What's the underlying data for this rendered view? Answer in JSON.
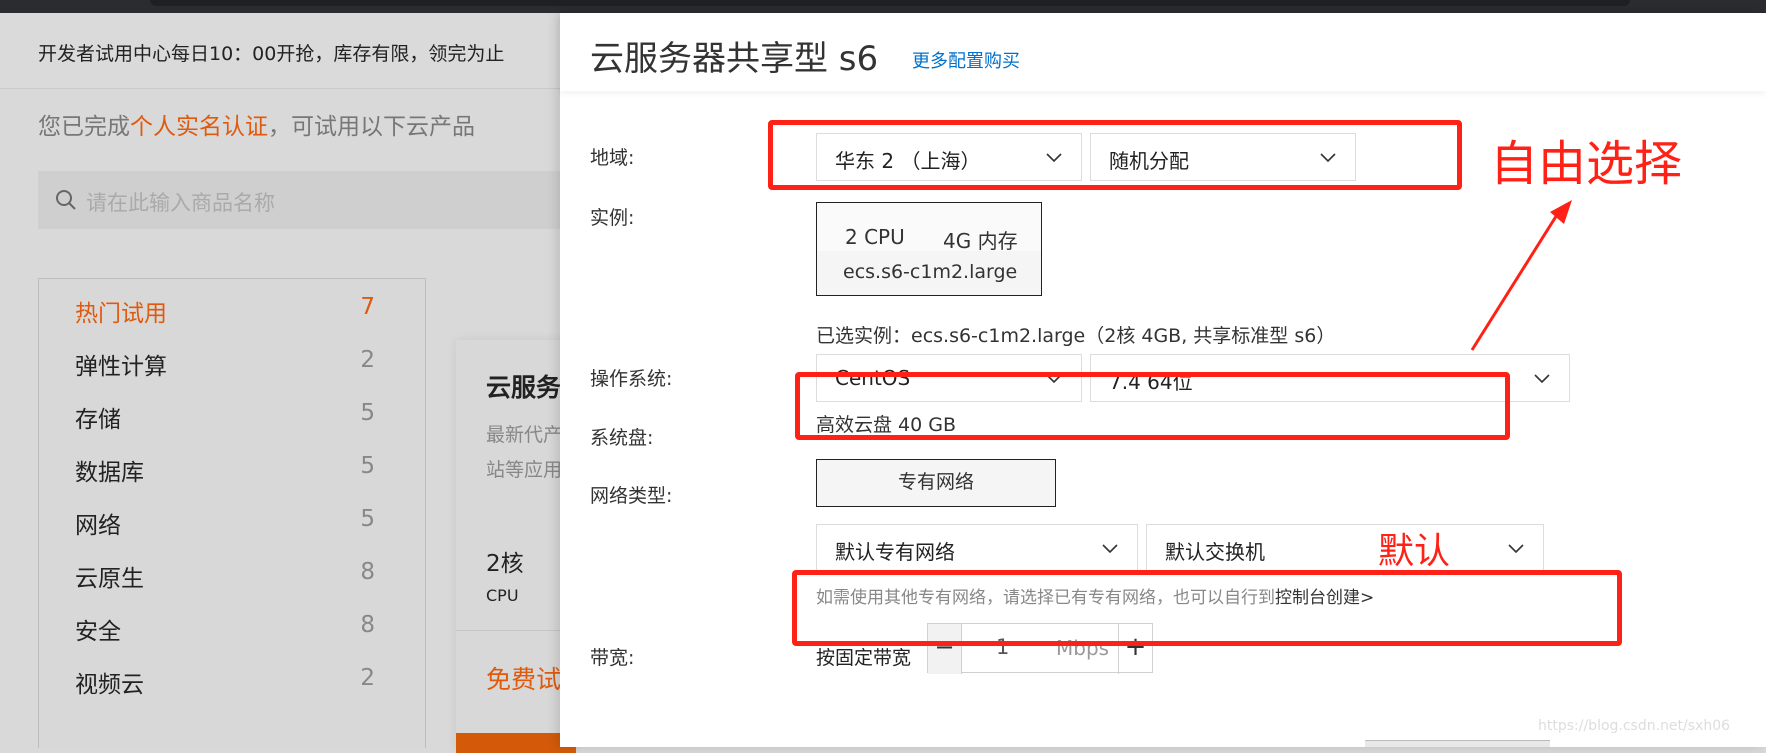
{
  "background_page": {
    "notice": "开发者试用中心每日10：00开抢，库存有限，领完为止",
    "verified_prefix": "您已完成",
    "verified_highlight": "个人实名认证",
    "verified_suffix": "，可试用以下云产品",
    "search_placeholder": "请在此输入商品名称",
    "categories": [
      {
        "label": "热门试用",
        "count": "7",
        "active": true
      },
      {
        "label": "弹性计算",
        "count": "2"
      },
      {
        "label": "存储",
        "count": "5"
      },
      {
        "label": "数据库",
        "count": "5"
      },
      {
        "label": "网络",
        "count": "5"
      },
      {
        "label": "云原生",
        "count": "8"
      },
      {
        "label": "安全",
        "count": "8"
      },
      {
        "label": "视频云",
        "count": "2"
      }
    ],
    "card": {
      "title": "云服务",
      "desc_line1": "最新代产",
      "desc_line2": "站等应用",
      "spec_value": "2核",
      "spec_label": "CPU",
      "free_label": "免费试"
    }
  },
  "drawer": {
    "title": "云服务器共享型 s6",
    "more_config_link": "更多配置购买",
    "region": {
      "label": "地域:",
      "region_value": "华东 2 （上海）",
      "zone_value": "随机分配"
    },
    "instance": {
      "label": "实例:",
      "cpu": "2 CPU",
      "memory": "4G 内存",
      "code": "ecs.s6-c1m2.large",
      "selected_text": "已选实例：ecs.s6-c1m2.large（2核 4GB, 共享标准型 s6）"
    },
    "os": {
      "label": "操作系统:",
      "os_value": "CentOS",
      "version_value": "7.4 64位"
    },
    "disk": {
      "label": "系统盘:",
      "value": "高效云盘 40 GB"
    },
    "network": {
      "label": "网络类型:",
      "type_button": "专有网络",
      "vpc_value": "默认专有网络",
      "vswitch_value": "默认交换机",
      "hint_prefix": "如需使用其他专有网络，请选择已有专有网络，也可以自行到",
      "hint_link": "控制台创建>"
    },
    "bandwidth": {
      "label": "带宽:",
      "mode": "按固定带宽",
      "minus": "−",
      "value": "1",
      "unit": "Mbps",
      "plus": "+"
    }
  },
  "annotations": {
    "free_choice": "自由选择",
    "default": "默认",
    "color": "#ff2016"
  },
  "watermark": "https://blog.csdn.net/sxh06"
}
